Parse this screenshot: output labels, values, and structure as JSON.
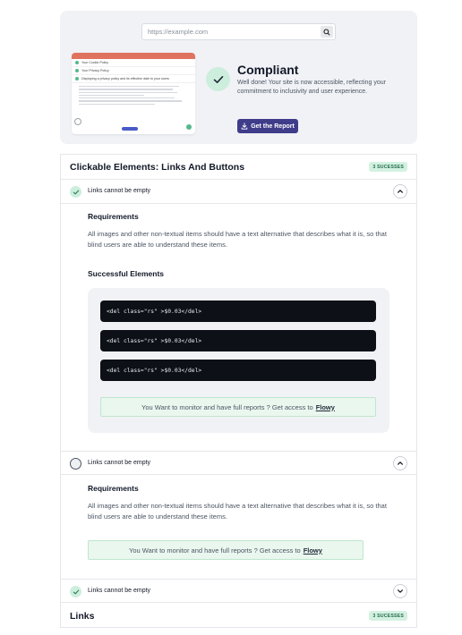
{
  "search": {
    "placeholder": "https://example.com",
    "button_icon": "search-icon"
  },
  "preview": {
    "items": [
      "Your Cookie Policy",
      "Your Privacy Policy",
      "Displaying a privacy policy and its effective date to your users"
    ]
  },
  "hero": {
    "title": "Compliant",
    "message": "Well done! Your site is now accessible, reflecting your commitment to inclusivity and user experience.",
    "button_label": "Get the Report",
    "accent": "#3f3c8a",
    "success_color": "#55b98a"
  },
  "section1": {
    "title": "Clickable Elements: Links And Buttons",
    "badge": "3 SUCESSES",
    "acc1": {
      "label": "Links cannot be empty",
      "requirements_title": "Requirements",
      "requirements_text": "All images and other non-textual items should have a text alternative that describes what it is, so that blind users are able to understand these items.",
      "successful_title": "Successful Elements",
      "code_items": [
        "<del class=\"rs\" >$0.03</del>",
        "<del class=\"rs\" >$0.03</del>",
        "<del class=\"rs\" >$0.03</del>"
      ],
      "cta_text": "You Want to monitor and have full reports ? Get access to",
      "cta_link": "Flowy"
    },
    "acc2": {
      "label": "Links cannot be empty",
      "requirements_title": "Requirements",
      "requirements_text": "All images and other non-textual items should have a text alternative that describes what it is, so that blind users are able to understand these items.",
      "cta_text": "You Want to monitor and have full reports ? Get access to",
      "cta_link": "Flowy"
    },
    "acc3": {
      "label": "Links cannot be empty"
    }
  },
  "section2": {
    "title": "Links",
    "badge": "3 SUCESSES"
  }
}
